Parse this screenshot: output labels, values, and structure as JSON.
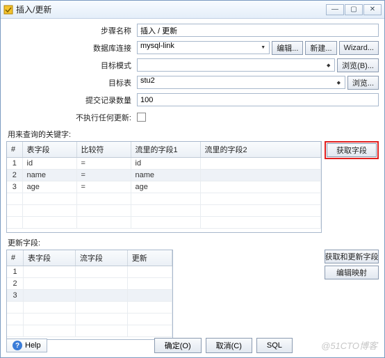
{
  "window": {
    "title": "插入/更新",
    "controls": {
      "min": "—",
      "max": "▢",
      "close": "✕"
    }
  },
  "form": {
    "step_label": "步骤名称",
    "step_value": "插入 / 更新",
    "conn_label": "数据库连接",
    "conn_value": "mysql-link",
    "edit_btn": "编辑...",
    "new_btn": "新建...",
    "wizard_btn": "Wizard...",
    "schema_label": "目标模式",
    "schema_value": "",
    "browse_b_btn": "浏览(B)...",
    "table_label": "目标表",
    "table_value": "stu2",
    "browse_btn": "浏览...",
    "commit_label": "提交记录数量",
    "commit_value": "100",
    "noupdate_label": "不执行任何更新:"
  },
  "query_section": {
    "label": "用来查询的关键字:",
    "get_fields_btn": "获取字段",
    "columns": {
      "num": "#",
      "field": "表字段",
      "comp": "比较符",
      "s1": "流里的字段1",
      "s2": "流里的字段2"
    },
    "rows": [
      {
        "n": "1",
        "field": "id",
        "comp": "=",
        "s1": "id",
        "s2": ""
      },
      {
        "n": "2",
        "field": "name",
        "comp": "=",
        "s1": "name",
        "s2": ""
      },
      {
        "n": "3",
        "field": "age",
        "comp": "=",
        "s1": "age",
        "s2": ""
      }
    ]
  },
  "update_section": {
    "label": "更新字段:",
    "get_update_btn": "获取和更新字段",
    "edit_map_btn": "编辑映射",
    "columns": {
      "num": "#",
      "field": "表字段",
      "stream": "流字段",
      "update": "更新"
    },
    "rows": [
      {
        "n": "1"
      },
      {
        "n": "2"
      },
      {
        "n": "3"
      }
    ]
  },
  "bottom": {
    "help": "Help",
    "ok": "确定(O)",
    "cancel": "取消(C)",
    "sql": "SQL"
  },
  "watermark": "@51CTO博客"
}
